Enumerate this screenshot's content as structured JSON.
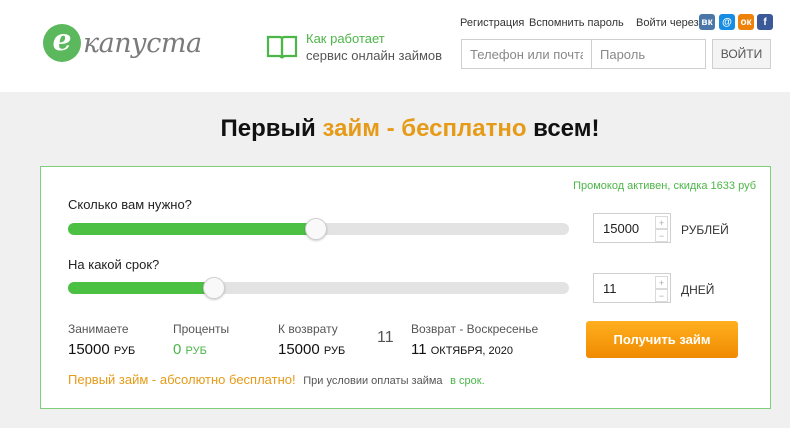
{
  "header": {
    "logo_letter": "e",
    "logo_text": "капуста",
    "how_line1": "Как работает",
    "how_line2": "сервис онлайн займов",
    "register_link": "Регистрация",
    "remember_link": "Вспомнить пароль",
    "login_via": "Войти через",
    "social": [
      {
        "icon": "vk-icon",
        "glyph": "вк",
        "color": "#4a76a8"
      },
      {
        "icon": "mail-icon",
        "glyph": "@",
        "color": "#168de2"
      },
      {
        "icon": "odnoklassniki-icon",
        "glyph": "ок",
        "color": "#ee8208"
      },
      {
        "icon": "facebook-icon",
        "glyph": "f",
        "color": "#3b5998"
      }
    ],
    "phone_placeholder": "Телефон или почта",
    "password_placeholder": "Пароль",
    "login_button": "войти"
  },
  "headline": {
    "part1": "Первый",
    "part2": "займ - бесплатно",
    "part3": "всем!"
  },
  "calculator": {
    "promo": "Промокод активен, скидка 1633 руб",
    "amount_label": "Сколько вам нужно?",
    "amount_value": "15000",
    "amount_unit": "РУБЛЕЙ",
    "amount_fraction": 0.495,
    "term_label": "На какой срок?",
    "term_value": "11",
    "term_unit": "ДНЕЙ",
    "term_fraction": 0.292,
    "borrow_label": "Занимаете",
    "borrow_value": "15000",
    "borrow_unit": "РУБ",
    "percent_label": "Проценты",
    "percent_value": "0",
    "percent_unit": "РУБ",
    "return_label": "К возврату",
    "return_value": "15000",
    "return_unit": "РУБ",
    "days_value": "11",
    "return_date_label": "Возврат - Воскресенье",
    "return_date_day": "11",
    "return_date_month": "ОКТЯБРЯ, 2020",
    "get_button": "Получить займ",
    "free_text": "Первый займ - абсолютно бесплатно!",
    "condition_text": "При условии оплаты займа",
    "condition_link": "в срок."
  },
  "colors": {
    "green": "#4cc043",
    "orange": "#e59b18"
  }
}
